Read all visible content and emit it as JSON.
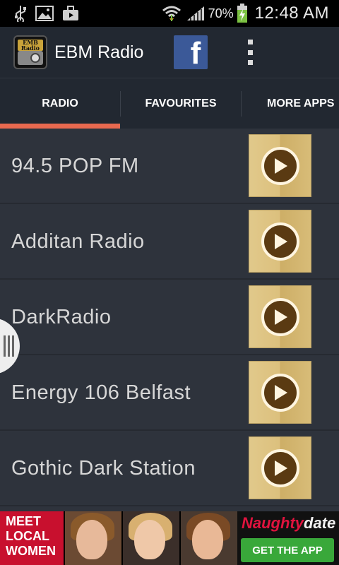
{
  "status_bar": {
    "icons": [
      "usb-icon",
      "image-icon",
      "briefcase-icon",
      "wifi-icon",
      "signal-icon",
      "battery-charging-icon"
    ],
    "battery_percent": "70%",
    "time": "12:48 AM"
  },
  "app_bar": {
    "logo_text": "EMB Radio",
    "title": "EBM Radio",
    "facebook_glyph": "f"
  },
  "tabs": [
    {
      "label": "RADIO",
      "selected": true
    },
    {
      "label": "FAVOURITES",
      "selected": false
    },
    {
      "label": "MORE APPS",
      "selected": false
    }
  ],
  "stations": [
    {
      "name": "94.5 POP FM"
    },
    {
      "name": "Additan Radio"
    },
    {
      "name": "DarkRadio"
    },
    {
      "name": "Energy 106 Belfast"
    },
    {
      "name": "Gothic Dark Station"
    }
  ],
  "ad": {
    "left_text": "MEET LOCAL WOMEN",
    "brand_part1": "Naughty",
    "brand_part2": "date",
    "cta": "GET THE APP"
  },
  "colors": {
    "accent": "#e8694f",
    "background": "#2e333c",
    "app_bar": "#222831",
    "facebook": "#3b5998",
    "play_gold": "#dcc07d",
    "play_brown": "#5a3a12"
  }
}
